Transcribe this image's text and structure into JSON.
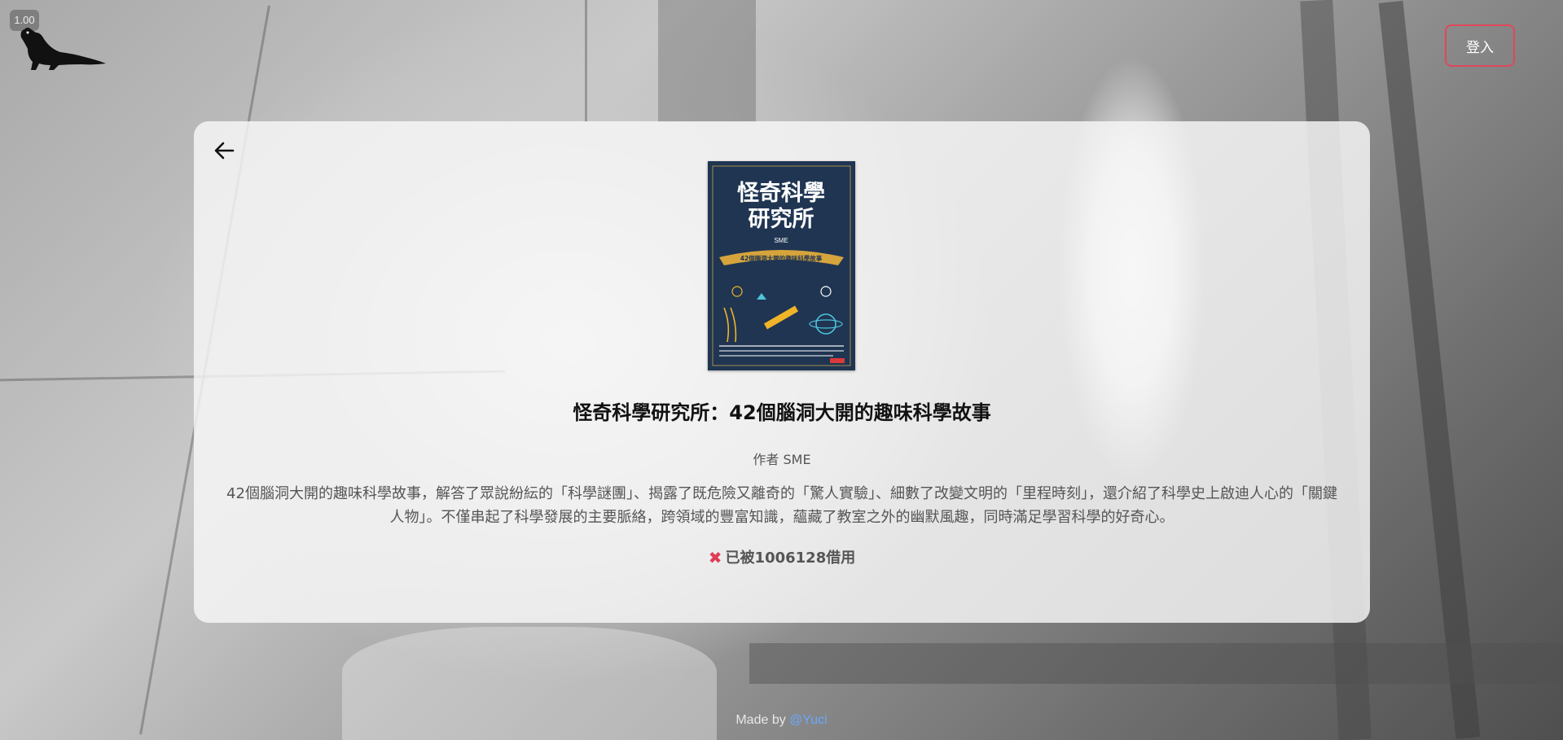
{
  "header": {
    "zoom_level": "1.00",
    "login_label": "登入"
  },
  "book": {
    "cover": {
      "title_line1": "怪奇科學",
      "title_line2": "研究所",
      "author_mark": "SME",
      "banner": "42個腦洞大開的趣味科學故事",
      "colors": {
        "background": "#1f3552",
        "accent": "#f0b429",
        "text": "#ffffff"
      }
    },
    "title": "怪奇科學研究所：42個腦洞大開的趣味科學故事",
    "author": "作者 SME",
    "description": "42個腦洞大開的趣味科學故事，解答了眾說紛紜的「科學謎團」、揭露了既危險又離奇的「驚人實驗」、細數了改變文明的「里程時刻」，還介紹了科學史上啟迪人心的「關鍵人物」。不僅串起了科學發展的主要脈絡，跨領域的豐富知識，蘊藏了教室之外的幽默風趣，同時滿足學習科學的好奇心。",
    "status": "已被1006128借用",
    "status_icon": "x-icon",
    "status_color": "#e03c55"
  },
  "footer": {
    "made_by": "Made by",
    "author_link": "@Yuci"
  },
  "colors": {
    "login_border": "#e0485a",
    "link": "#6aa8ff"
  }
}
